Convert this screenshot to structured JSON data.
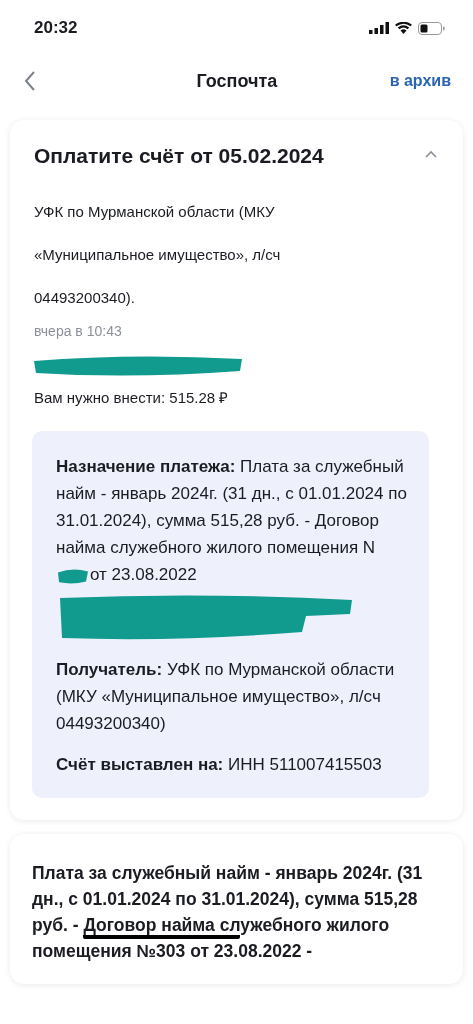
{
  "status_bar": {
    "time": "20:32"
  },
  "header": {
    "title": "Госпочта",
    "action": "в архив"
  },
  "message": {
    "title": "Оплатите счёт от 05.02.2024",
    "expanded": true,
    "sender_lines": [
      "УФК по Мурманской области (МКУ",
      "«Муниципальное имущество», л/сч",
      "04493200340)."
    ],
    "time": "вчера в 10:43",
    "amount": "Вам нужно внести: 515.28 ₽",
    "details": [
      {
        "kind": "purpose",
        "label": "Назначение платежа:",
        "parts": [
          {
            "kind": "text",
            "text": "Плата за служебный найм - январь 2024г. (31 дн., с 01.01.2024 по 31.01.2024), сумма 515,28 руб. - Договор найма служебного жилого помещения N"
          },
          {
            "kind": "redacted"
          },
          {
            "kind": "text",
            "text": "от 23.08.2022"
          },
          {
            "kind": "redacted_block"
          }
        ]
      },
      {
        "kind": "plain",
        "label": "Получатель:",
        "text": "УФК по Мурманской области (МКУ «Муниципальное имущество», л/сч 04493200340)"
      },
      {
        "kind": "plain",
        "label": "Счёт выставлен на:",
        "text": "ИНН 511007415503"
      }
    ]
  },
  "summary": {
    "parts": [
      {
        "text": "Плата за служебный найм - январь 2024г. (31 дн., с 01.01.2024 по 31.01.2024), сумма 515,28 руб. - ",
        "marked": false
      },
      {
        "text": "Договор найма сл",
        "marked": true
      },
      {
        "text": "ужебного жилого помещения №303 от 23.08.2022 -",
        "marked": false
      }
    ]
  }
}
